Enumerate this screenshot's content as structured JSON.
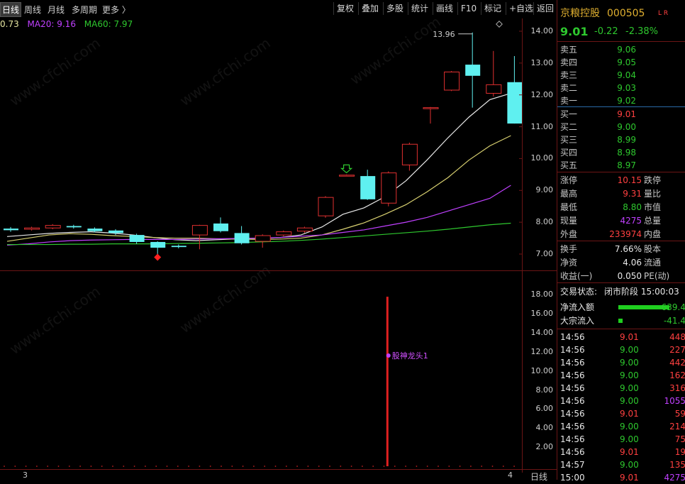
{
  "toolbar": {
    "left_items": [
      "日线",
      "周线",
      "月线",
      "多周期",
      "更多 〉"
    ],
    "right_items": [
      "复权",
      "叠加",
      "多股",
      "统计",
      "画线",
      "F10",
      "标记",
      "+自选",
      "返回"
    ]
  },
  "ma": {
    "ma10": "0.73",
    "ma20_label": "MA20: 9.16",
    "ma60_label": "MA60: 7.97",
    "colors": {
      "ma10": "#e6e6a0",
      "ma20": "#c040ff",
      "ma60": "#2ec82e"
    }
  },
  "price_axis": [
    "14.00",
    "13.00",
    "12.00",
    "11.00",
    "10.00",
    "9.00",
    "8.00",
    "7.00"
  ],
  "volume_axis": [
    "18.00",
    "16.00",
    "14.00",
    "12.00",
    "10.00",
    "8.00",
    "6.00",
    "4.00",
    "2.00"
  ],
  "chart_data": {
    "type": "candlestick",
    "high_label": "13.96",
    "indicator_label": "股神龙头1",
    "candles": [
      {
        "o": 7.8,
        "c": 7.75,
        "h": 7.85,
        "l": 7.7,
        "up": false
      },
      {
        "o": 7.78,
        "c": 7.82,
        "h": 7.86,
        "l": 7.74,
        "up": true
      },
      {
        "o": 7.82,
        "c": 7.9,
        "h": 7.94,
        "l": 7.78,
        "up": true
      },
      {
        "o": 7.88,
        "c": 7.84,
        "h": 7.92,
        "l": 7.8,
        "up": false
      },
      {
        "o": 7.8,
        "c": 7.72,
        "h": 7.84,
        "l": 7.68,
        "up": false
      },
      {
        "o": 7.74,
        "c": 7.66,
        "h": 7.78,
        "l": 7.6,
        "up": false
      },
      {
        "o": 7.6,
        "c": 7.38,
        "h": 7.64,
        "l": 7.32,
        "up": false
      },
      {
        "o": 7.38,
        "c": 7.2,
        "h": 7.4,
        "l": 6.95,
        "up": false
      },
      {
        "o": 7.26,
        "c": 7.22,
        "h": 7.3,
        "l": 7.18,
        "up": false
      },
      {
        "o": 7.6,
        "c": 7.9,
        "h": 7.92,
        "l": 7.15,
        "up": true
      },
      {
        "o": 7.96,
        "c": 7.72,
        "h": 8.15,
        "l": 7.68,
        "up": false
      },
      {
        "o": 7.66,
        "c": 7.34,
        "h": 7.88,
        "l": 7.3,
        "up": false
      },
      {
        "o": 7.4,
        "c": 7.58,
        "h": 7.62,
        "l": 7.2,
        "up": true
      },
      {
        "o": 7.6,
        "c": 7.7,
        "h": 7.74,
        "l": 7.56,
        "up": true
      },
      {
        "o": 7.72,
        "c": 7.82,
        "h": 7.86,
        "l": 7.66,
        "up": true
      },
      {
        "o": 8.2,
        "c": 8.78,
        "h": 8.82,
        "l": 8.14,
        "up": true
      },
      {
        "o": 9.48,
        "c": 9.48,
        "h": 9.5,
        "l": 9.46,
        "up": true
      },
      {
        "o": 9.45,
        "c": 8.72,
        "h": 9.65,
        "l": 8.7,
        "up": false
      },
      {
        "o": 8.6,
        "c": 9.55,
        "h": 9.6,
        "l": 8.5,
        "up": true
      },
      {
        "o": 9.8,
        "c": 10.45,
        "h": 10.5,
        "l": 9.62,
        "up": true
      },
      {
        "o": 11.6,
        "c": 11.6,
        "h": 11.62,
        "l": 11.1,
        "up": true
      },
      {
        "o": 12.15,
        "c": 12.72,
        "h": 12.75,
        "l": 12.12,
        "up": true
      },
      {
        "o": 12.95,
        "c": 12.6,
        "h": 13.96,
        "l": 11.6,
        "up": false
      },
      {
        "o": 12.05,
        "c": 12.32,
        "h": 13.38,
        "l": 11.95,
        "up": true
      },
      {
        "o": 12.4,
        "c": 11.1,
        "h": 13.22,
        "l": 11.1,
        "up": false
      }
    ],
    "ma_lines": {
      "ma10": [
        7.55,
        7.6,
        7.65,
        7.68,
        7.7,
        7.66,
        7.6,
        7.52,
        7.45,
        7.42,
        7.45,
        7.48,
        7.5,
        7.52,
        7.6,
        7.85,
        8.25,
        8.45,
        8.8,
        9.3,
        9.95,
        10.65,
        11.3,
        11.85,
        12.05
      ],
      "ma20": [
        7.4,
        7.5,
        7.6,
        7.64,
        7.62,
        7.58,
        7.55,
        7.52,
        7.5,
        7.5,
        7.48,
        7.47,
        7.46,
        7.47,
        7.5,
        7.6,
        7.78,
        7.98,
        8.25,
        8.55,
        8.95,
        9.4,
        9.95,
        10.4,
        10.72
      ],
      "ma60": [
        7.28,
        7.32,
        7.38,
        7.42,
        7.44,
        7.45,
        7.46,
        7.46,
        7.46,
        7.47,
        7.48,
        7.49,
        7.5,
        7.52,
        7.56,
        7.6,
        7.68,
        7.76,
        7.88,
        8.0,
        8.15,
        8.35,
        8.55,
        8.75,
        9.16
      ],
      "ma80": [
        7.3,
        7.3,
        7.3,
        7.31,
        7.31,
        7.32,
        7.32,
        7.32,
        7.33,
        7.34,
        7.35,
        7.36,
        7.38,
        7.4,
        7.43,
        7.47,
        7.52,
        7.57,
        7.62,
        7.67,
        7.72,
        7.78,
        7.85,
        7.92,
        7.97
      ]
    },
    "volume_bar": {
      "index": 18,
      "value": 17.8
    },
    "ylim": [
      6.7,
      14.4
    ],
    "vol_ylim": [
      0,
      19
    ]
  },
  "bottom": {
    "left_label": "3",
    "right_label": "4",
    "period": "日线"
  },
  "panel": {
    "name": "京粮控股",
    "code": "000505",
    "flags": "L R",
    "price": "9.01",
    "change": "-0.22",
    "change_pct": "-2.38%",
    "asks": [
      {
        "label": "卖五",
        "price": "9.06"
      },
      {
        "label": "卖四",
        "price": "9.05"
      },
      {
        "label": "卖三",
        "price": "9.04"
      },
      {
        "label": "卖二",
        "price": "9.03"
      },
      {
        "label": "卖一",
        "price": "9.02"
      }
    ],
    "bids": [
      {
        "label": "买一",
        "price": "9.01"
      },
      {
        "label": "买二",
        "price": "9.00"
      },
      {
        "label": "买三",
        "price": "8.99"
      },
      {
        "label": "买四",
        "price": "8.98"
      },
      {
        "label": "买五",
        "price": "8.97"
      }
    ],
    "stats": [
      {
        "label": "涨停",
        "value": "10.15",
        "cls": "red",
        "label2": "跌停"
      },
      {
        "label": "最高",
        "value": "9.31",
        "cls": "red",
        "label2": "量比"
      },
      {
        "label": "最低",
        "value": "8.80",
        "cls": "green",
        "label2": "市值"
      },
      {
        "label": "现量",
        "value": "4275",
        "cls": "purple",
        "label2": "总量"
      },
      {
        "label": "外盘",
        "value": "233974",
        "cls": "red",
        "label2": "内盘"
      }
    ],
    "stats2": [
      {
        "label": "换手",
        "value": "7.66%",
        "label2": "股本"
      },
      {
        "label": "净资",
        "value": "4.06",
        "label2": "流通"
      },
      {
        "label": "收益(一)",
        "value": "0.050",
        "label2": "PE(动)"
      }
    ],
    "status_label": "交易状态:",
    "status_value": "闭市阶段 15:00:03",
    "flow1_label": "净流入额",
    "flow1_value": "-639.4",
    "flow2_label": "大宗流入",
    "flow2_value": "-41.4",
    "trades": [
      {
        "t": "14:56",
        "p": "9.01",
        "v": "448",
        "pc": "red",
        "vc": "red"
      },
      {
        "t": "14:56",
        "p": "9.00",
        "v": "227",
        "pc": "green",
        "vc": "red"
      },
      {
        "t": "14:56",
        "p": "9.00",
        "v": "442",
        "pc": "green",
        "vc": "red"
      },
      {
        "t": "14:56",
        "p": "9.00",
        "v": "162",
        "pc": "green",
        "vc": "red"
      },
      {
        "t": "14:56",
        "p": "9.00",
        "v": "316",
        "pc": "green",
        "vc": "red"
      },
      {
        "t": "14:56",
        "p": "9.00",
        "v": "1055",
        "pc": "green",
        "vc": "purple"
      },
      {
        "t": "14:56",
        "p": "9.01",
        "v": "59",
        "pc": "red",
        "vc": "red"
      },
      {
        "t": "14:56",
        "p": "9.00",
        "v": "214",
        "pc": "green",
        "vc": "red"
      },
      {
        "t": "14:56",
        "p": "9.00",
        "v": "75",
        "pc": "green",
        "vc": "red"
      },
      {
        "t": "14:56",
        "p": "9.01",
        "v": "19",
        "pc": "red",
        "vc": "red"
      },
      {
        "t": "14:57",
        "p": "9.00",
        "v": "135",
        "pc": "green",
        "vc": "red"
      },
      {
        "t": "15:00",
        "p": "9.01",
        "v": "4275",
        "pc": "red",
        "vc": "purple"
      }
    ],
    "watermark": "www.cfchi.com"
  }
}
